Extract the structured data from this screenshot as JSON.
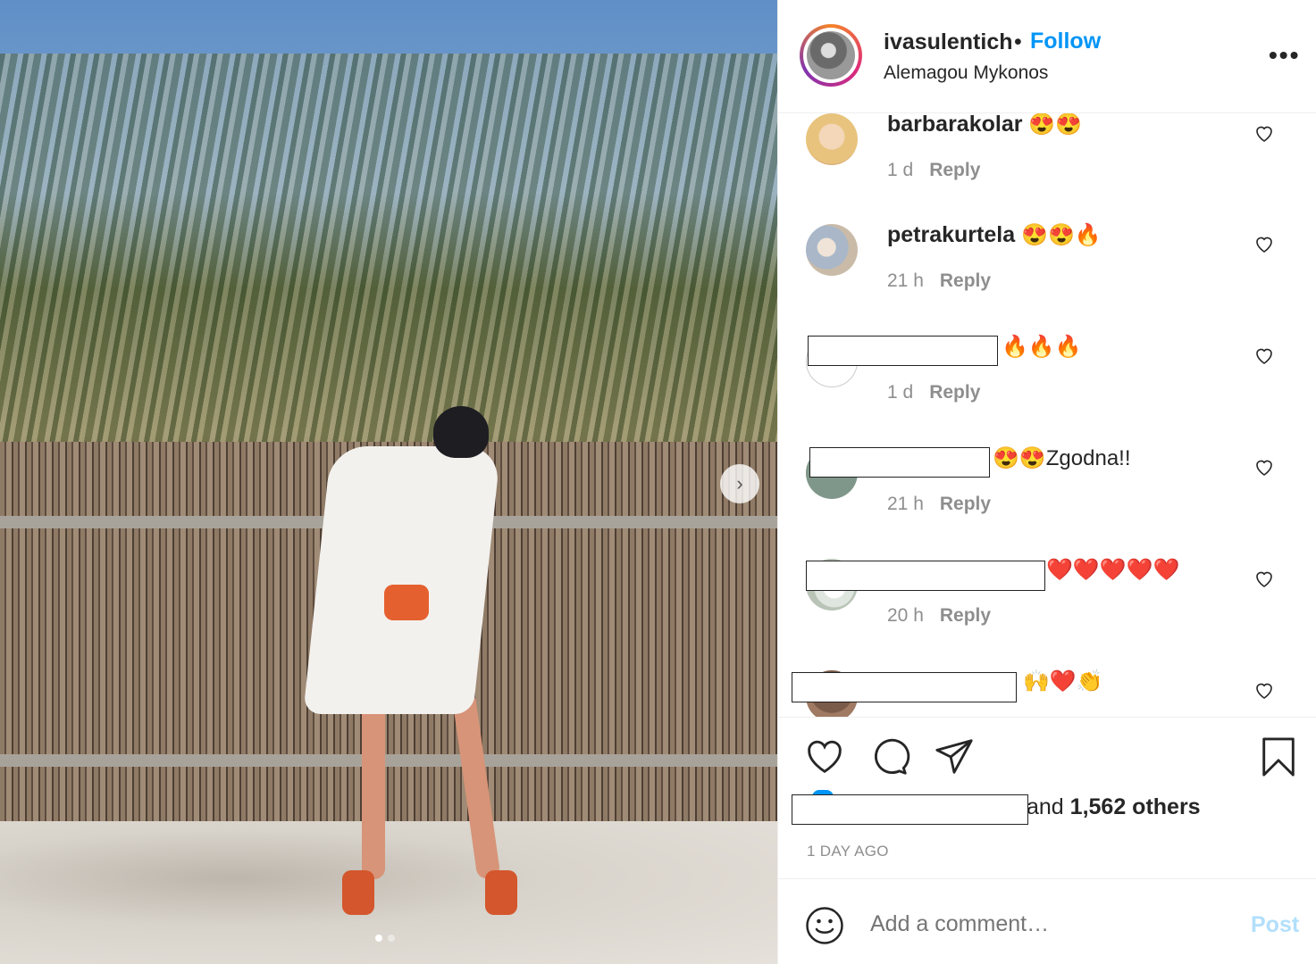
{
  "post": {
    "username": "ivasulentich",
    "separator": "•",
    "follow_label": "Follow",
    "location": "Alemagou Mykonos",
    "more_label": "•••",
    "next_label": "›"
  },
  "comments": [
    {
      "username": "barbarakolar",
      "text": "😍😍",
      "time": "1 d",
      "reply": "Reply",
      "redacted": false
    },
    {
      "username": "petrakurtela",
      "text": "😍😍🔥",
      "time": "21 h",
      "reply": "Reply",
      "redacted": false
    },
    {
      "username": "",
      "text": "🔥🔥🔥",
      "time": "1 d",
      "reply": "Reply",
      "redacted": true
    },
    {
      "username": "",
      "text": "😍😍Zgodna!!",
      "time": "21 h",
      "reply": "Reply",
      "redacted": true
    },
    {
      "username": "",
      "text": "❤️❤️❤️❤️❤️",
      "time": "20 h",
      "reply": "Reply",
      "redacted": true
    },
    {
      "username": "",
      "text": "🙌❤️👏",
      "time": "",
      "reply": "",
      "redacted": true
    }
  ],
  "likes": {
    "prefix": "and ",
    "count": "1,562 others"
  },
  "date": "1 DAY AGO",
  "add_comment": {
    "placeholder": "Add a comment…",
    "post_label": "Post"
  },
  "colors": {
    "accent": "#0095f6",
    "post_disabled": "#b2dffc",
    "muted": "#8e8e8e"
  }
}
